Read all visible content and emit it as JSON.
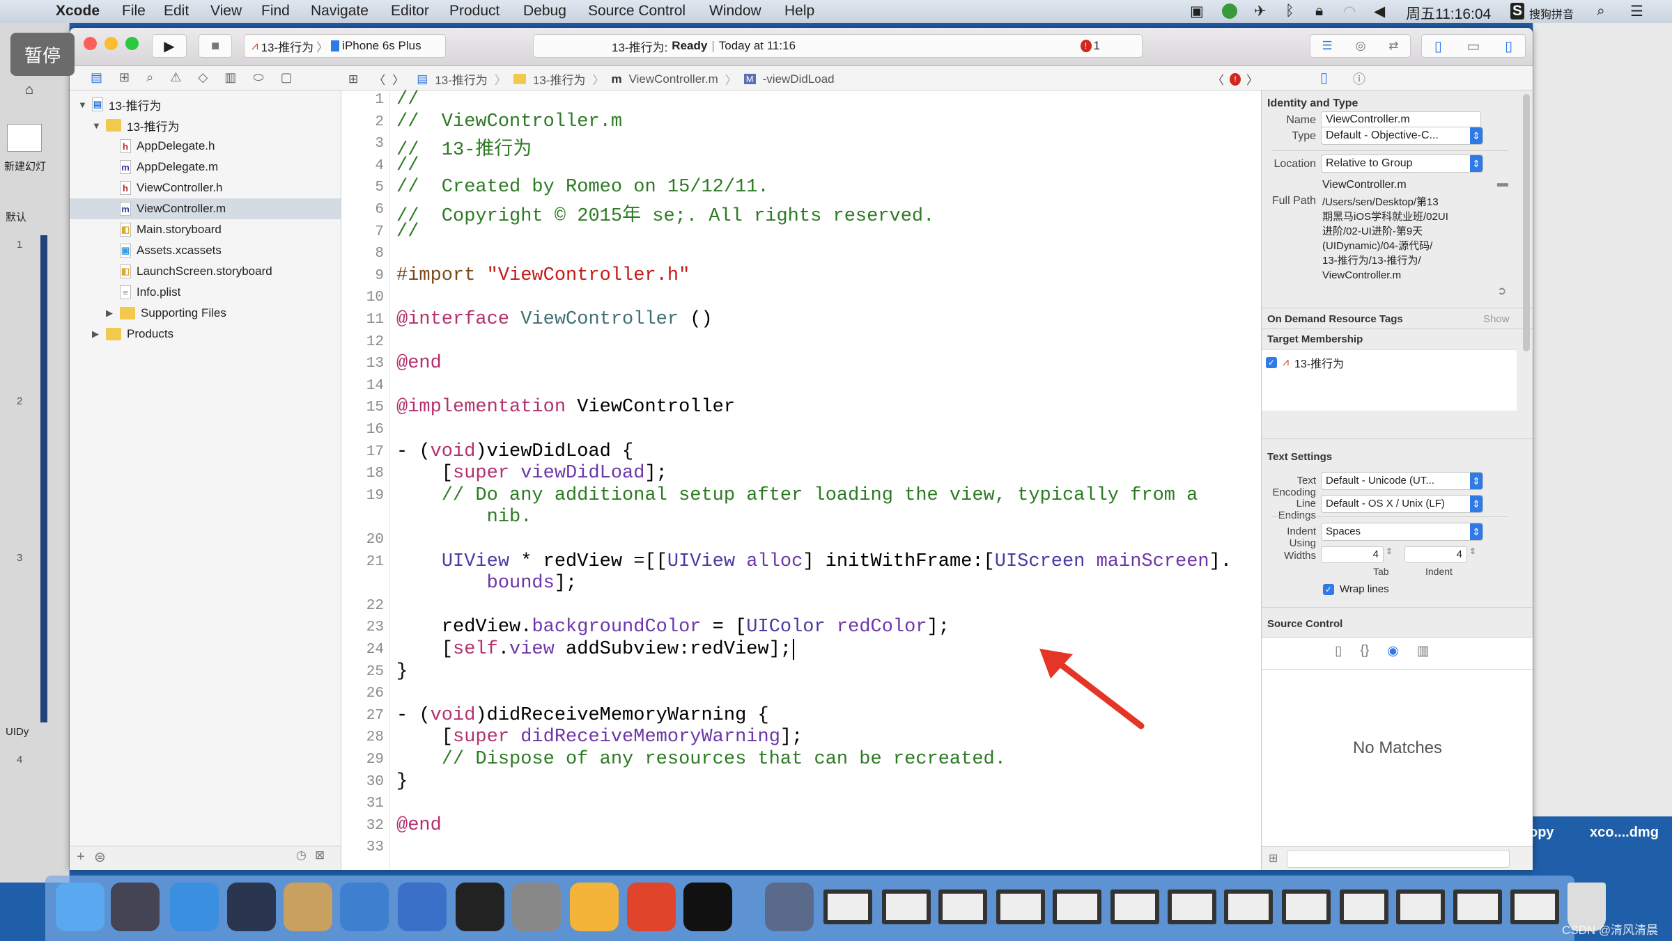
{
  "menubar": {
    "app": "Xcode",
    "items": [
      "File",
      "Edit",
      "View",
      "Find",
      "Navigate",
      "Editor",
      "Product",
      "Debug",
      "Source Control",
      "Window",
      "Help"
    ],
    "clock": "周五11:16:04",
    "input_method": "搜狗拼音"
  },
  "overlay": {
    "pause_label": "暂停"
  },
  "keynote": {
    "new_slide": "新建幻灯",
    "section1": "默认",
    "section2": "UIDy",
    "slide_numbers": [
      "1",
      "2",
      "3",
      "4"
    ]
  },
  "desktop": {
    "label1": "opy",
    "label2": "xco....dmg"
  },
  "toolbar": {
    "scheme": "13-推行为",
    "device": "iPhone 6s Plus",
    "activity_project": "13-推行为:",
    "activity_status": "Ready",
    "activity_time": "Today at 11:16",
    "error_count": "1"
  },
  "jumpbar": {
    "crumbs": [
      "13-推行为",
      "13-推行为",
      "ViewController.m",
      "-viewDidLoad"
    ]
  },
  "navigator": {
    "items": [
      {
        "label": "13-推行为",
        "kind": "project",
        "level": 0,
        "expanded": true
      },
      {
        "label": "13-推行为",
        "kind": "folder",
        "level": 1,
        "expanded": true
      },
      {
        "label": "AppDelegate.h",
        "kind": "h",
        "level": 2
      },
      {
        "label": "AppDelegate.m",
        "kind": "m",
        "level": 2
      },
      {
        "label": "ViewController.h",
        "kind": "h",
        "level": 2
      },
      {
        "label": "ViewController.m",
        "kind": "m",
        "level": 2,
        "selected": true
      },
      {
        "label": "Main.storyboard",
        "kind": "sb",
        "level": 2
      },
      {
        "label": "Assets.xcassets",
        "kind": "assets",
        "level": 2
      },
      {
        "label": "LaunchScreen.storyboard",
        "kind": "sb",
        "level": 2
      },
      {
        "label": "Info.plist",
        "kind": "plist",
        "level": 2
      },
      {
        "label": "Supporting Files",
        "kind": "folder",
        "level": 2,
        "expanded": false
      },
      {
        "label": "Products",
        "kind": "folder",
        "level": 1,
        "expanded": false
      }
    ]
  },
  "editor": {
    "lines": [
      {
        "n": "1",
        "t": "//"
      },
      {
        "n": "2",
        "t": "//  ViewController.m"
      },
      {
        "n": "3",
        "t": "//  13-推行为"
      },
      {
        "n": "4",
        "t": "//"
      },
      {
        "n": "5",
        "t": "//  Created by Romeo on 15/12/11."
      },
      {
        "n": "6",
        "t": "//  Copyright © 2015年 se;. All rights reserved."
      },
      {
        "n": "7",
        "t": "//"
      },
      {
        "n": "8",
        "t": ""
      },
      {
        "n": "9",
        "t": "#import \"ViewController.h\""
      },
      {
        "n": "10",
        "t": ""
      },
      {
        "n": "11",
        "t": "@interface ViewController ()"
      },
      {
        "n": "12",
        "t": ""
      },
      {
        "n": "13",
        "t": "@end"
      },
      {
        "n": "14",
        "t": ""
      },
      {
        "n": "15",
        "t": "@implementation ViewController"
      },
      {
        "n": "16",
        "t": ""
      },
      {
        "n": "17",
        "t": "- (void)viewDidLoad {"
      },
      {
        "n": "18",
        "t": "    [super viewDidLoad];"
      },
      {
        "n": "19",
        "t": "    // Do any additional setup after loading the view, typically from a",
        "wrap": "        nib."
      },
      {
        "n": "20",
        "t": ""
      },
      {
        "n": "21",
        "t": "    UIView * redView =[[UIView alloc] initWithFrame:[UIScreen mainScreen].",
        "wrap": "        bounds];"
      },
      {
        "n": "22",
        "t": ""
      },
      {
        "n": "23",
        "t": "    redView.backgroundColor = [UIColor redColor];"
      },
      {
        "n": "24",
        "t": "    [self.view addSubview:redView];"
      },
      {
        "n": "25",
        "t": "}"
      },
      {
        "n": "26",
        "t": ""
      },
      {
        "n": "27",
        "t": "- (void)didReceiveMemoryWarning {"
      },
      {
        "n": "28",
        "t": "    [super didReceiveMemoryWarning];"
      },
      {
        "n": "29",
        "t": "    // Dispose of any resources that can be recreated."
      },
      {
        "n": "30",
        "t": "}"
      },
      {
        "n": "31",
        "t": ""
      },
      {
        "n": "32",
        "t": "@end"
      },
      {
        "n": "33",
        "t": ""
      }
    ]
  },
  "inspector": {
    "identity_title": "Identity and Type",
    "name_label": "Name",
    "name_value": "ViewController.m",
    "type_label": "Type",
    "type_value": "Default - Objective-C...",
    "location_label": "Location",
    "location_value": "Relative to Group",
    "location_file": "ViewController.m",
    "fullpath_label": "Full Path",
    "fullpath_lines": [
      "/Users/sen/Desktop/第13",
      "期黑马iOS学科就业班/02UI",
      "进阶/02-UI进阶-第9天",
      "(UIDynamic)/04-源代码/",
      "13-推行为/13-推行为/",
      "ViewController.m"
    ],
    "odr_title": "On Demand Resource Tags",
    "odr_show": "Show",
    "target_title": "Target Membership",
    "target_name": "13-推行为",
    "target_checked": true,
    "text_title": "Text Settings",
    "encoding_label": "Text Encoding",
    "encoding_value": "Default - Unicode (UT...",
    "endings_label": "Line Endings",
    "endings_value": "Default - OS X / Unix (LF)",
    "indent_label": "Indent Using",
    "indent_value": "Spaces",
    "widths_label": "Widths",
    "tab_value": "4",
    "indent_value_n": "4",
    "tab_label": "Tab",
    "indent_sub_label": "Indent",
    "wrap_label": "Wrap lines",
    "wrap_checked": true,
    "sc_title": "Source Control",
    "no_matches": "No Matches"
  },
  "watermark": "CSDN @清风清晨",
  "colors": {
    "accent": "#2f7ae5",
    "arrow": "#e53526",
    "error": "#d0281e"
  }
}
